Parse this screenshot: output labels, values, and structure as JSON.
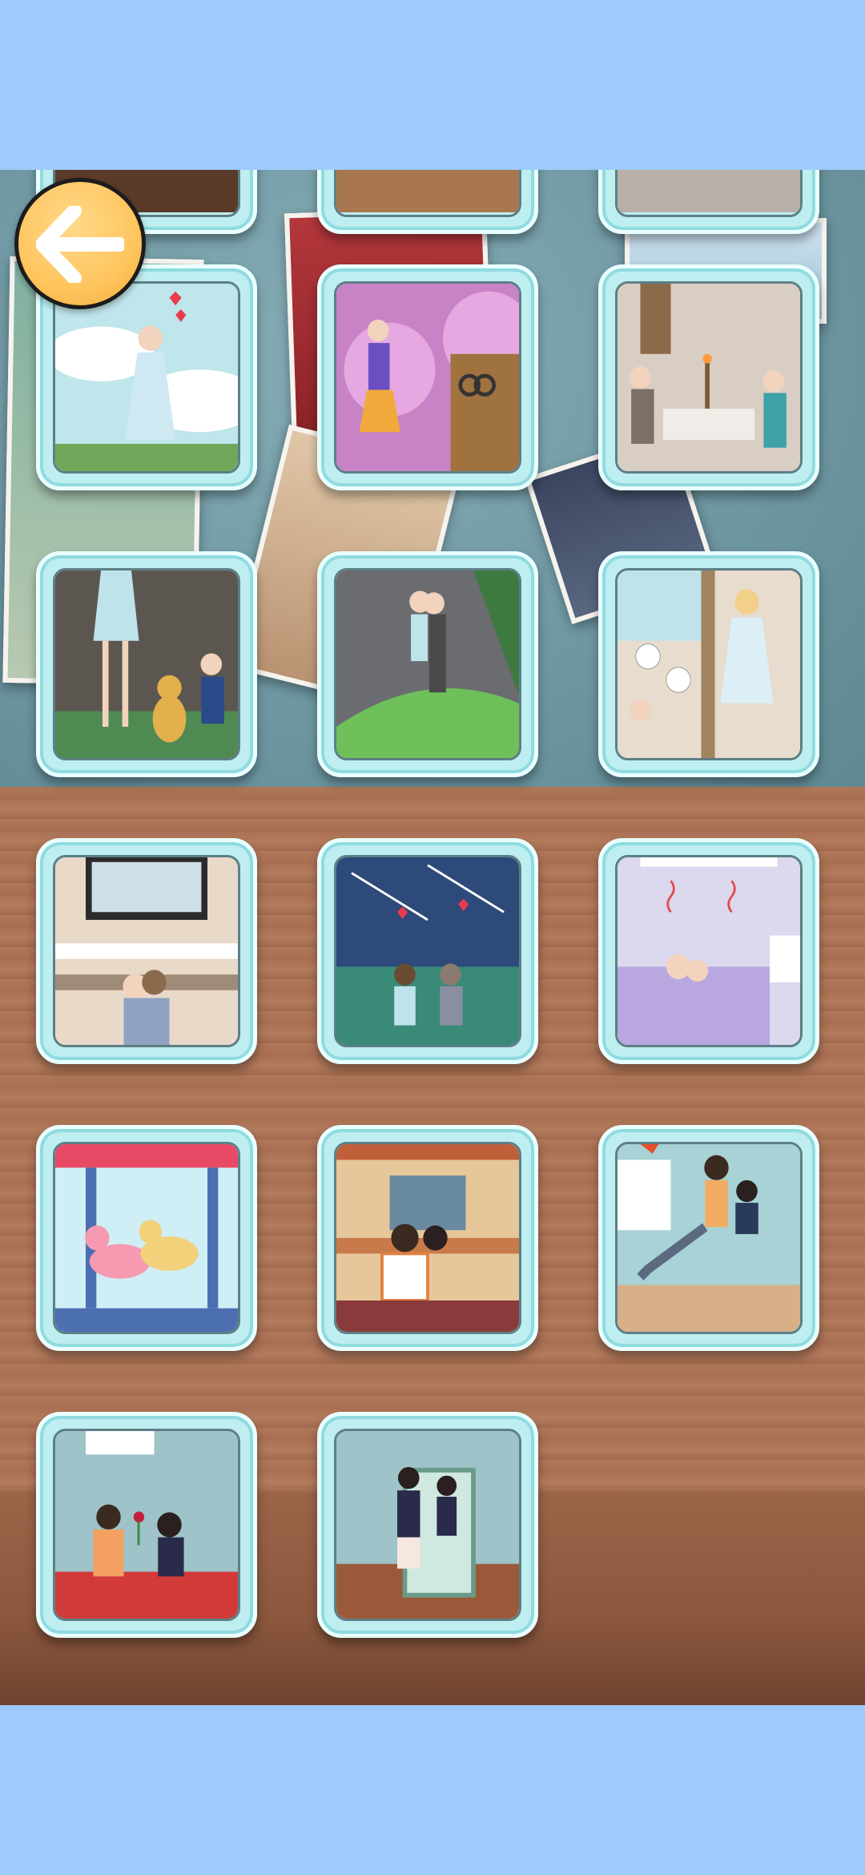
{
  "screen": {
    "background_color": "#9ecbfb",
    "wall_color": "#6f9aa5",
    "floor_color": "#ac7355",
    "card_frame_color": "#bfeef0"
  },
  "back_button": {
    "icon": "arrow-left-icon",
    "color": "#ffc55e"
  },
  "level_grid": {
    "columns": 3,
    "levels": [
      {
        "scene": "girl-in-clouds"
      },
      {
        "scene": "singer-handcuffs"
      },
      {
        "scene": "candlelight-dinner"
      },
      {
        "scene": "dog-on-leash"
      },
      {
        "scene": "kiss-on-hill"
      },
      {
        "scene": "kitchen-thoughts"
      },
      {
        "scene": "couple-watching-tv"
      },
      {
        "scene": "meteor-shower"
      },
      {
        "scene": "couple-in-bed"
      },
      {
        "scene": "carousel-ponies"
      },
      {
        "scene": "couple-at-desk"
      },
      {
        "scene": "carrying-girl"
      },
      {
        "scene": "rose-proposal"
      },
      {
        "scene": "mirror-reflection"
      }
    ]
  }
}
